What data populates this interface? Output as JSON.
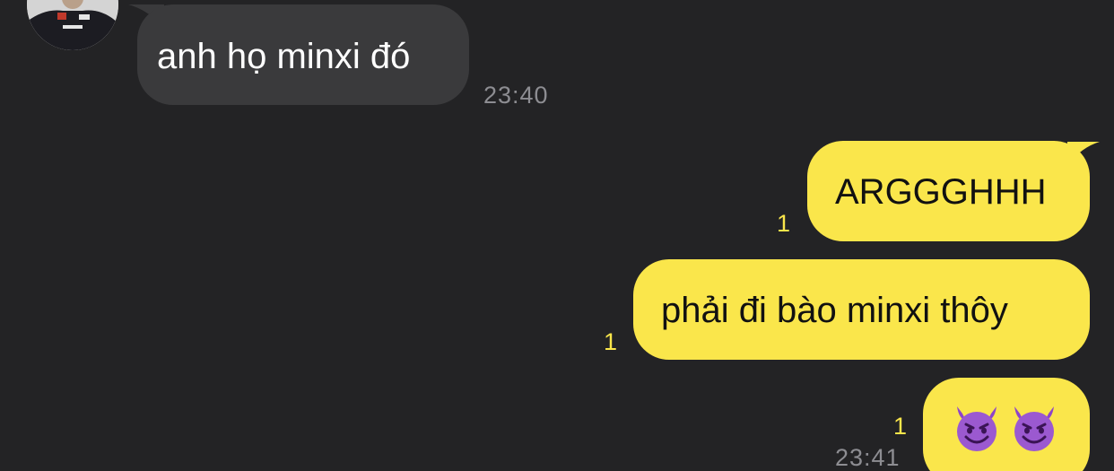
{
  "messages": [
    {
      "direction": "in",
      "text": "anh họ minxi đó",
      "time": "23:40"
    },
    {
      "direction": "out",
      "text": "ARGGGHHH",
      "read_count": "1"
    },
    {
      "direction": "out",
      "text": "phải đi bào minxi thôy",
      "read_count": "1"
    },
    {
      "direction": "out",
      "emoji": [
        "smiling-devil-emoji",
        "smiling-devil-emoji"
      ],
      "read_count": "1",
      "time": "23:41"
    }
  ],
  "colors": {
    "background": "#232325",
    "incoming_bubble": "#3a3a3c",
    "outgoing_bubble": "#fae64b",
    "read_count": "#fae64b",
    "timestamp": "#8d8d92"
  }
}
